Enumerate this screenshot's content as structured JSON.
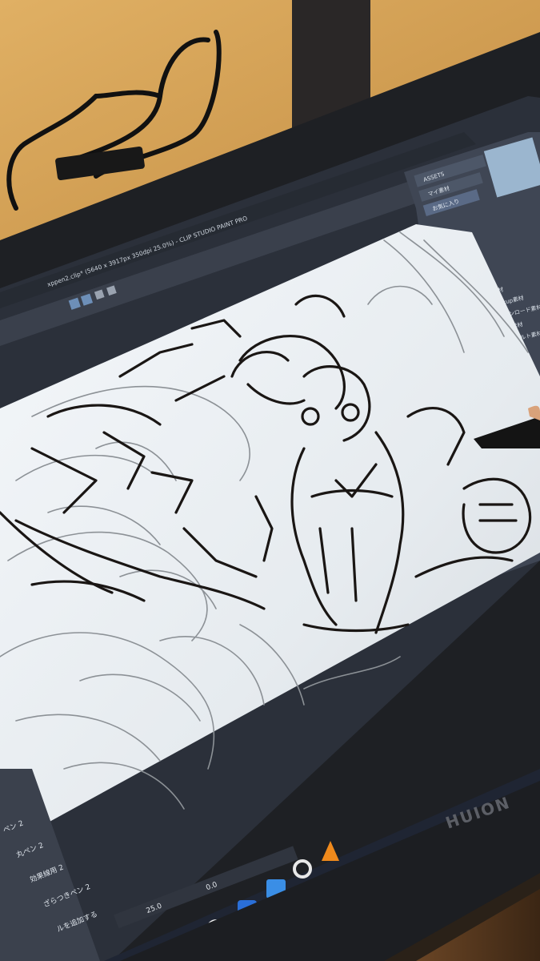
{
  "window": {
    "title": "xppen2.clip* (5640 x 3917px 350dpi 25.0%) - CLIP STUDIO PAINT PRO"
  },
  "asset_panel": {
    "items": [
      "ASSETS",
      "マイ素材",
      "お気に入り"
    ]
  },
  "material_list": {
    "items": [
      "素材",
      "Pickup素材",
      "ダウンロード素材",
      "追加素材",
      "デフォルト素材"
    ]
  },
  "brush_panel": {
    "items": [
      "ペン 2",
      "丸ペン 2",
      "効果線用 2",
      "ざらつきペン 2",
      "ルを追加する"
    ]
  },
  "status_bar": {
    "zoom": "25.0",
    "angle": "0.0"
  },
  "device": {
    "brand": "HUION"
  },
  "colors": {
    "wall": "#d6a55b",
    "bezel": "#1e2024",
    "canvas": "#e9eef2",
    "ui_panel": "#3f4654",
    "taskbar": "#1f2533",
    "ink": "#1a1614"
  },
  "icons": [
    "windows-start-icon",
    "edge-icon",
    "clip-studio-icon",
    "pen-app-icon",
    "photos-icon",
    "settings-gear-icon",
    "vlc-icon"
  ]
}
